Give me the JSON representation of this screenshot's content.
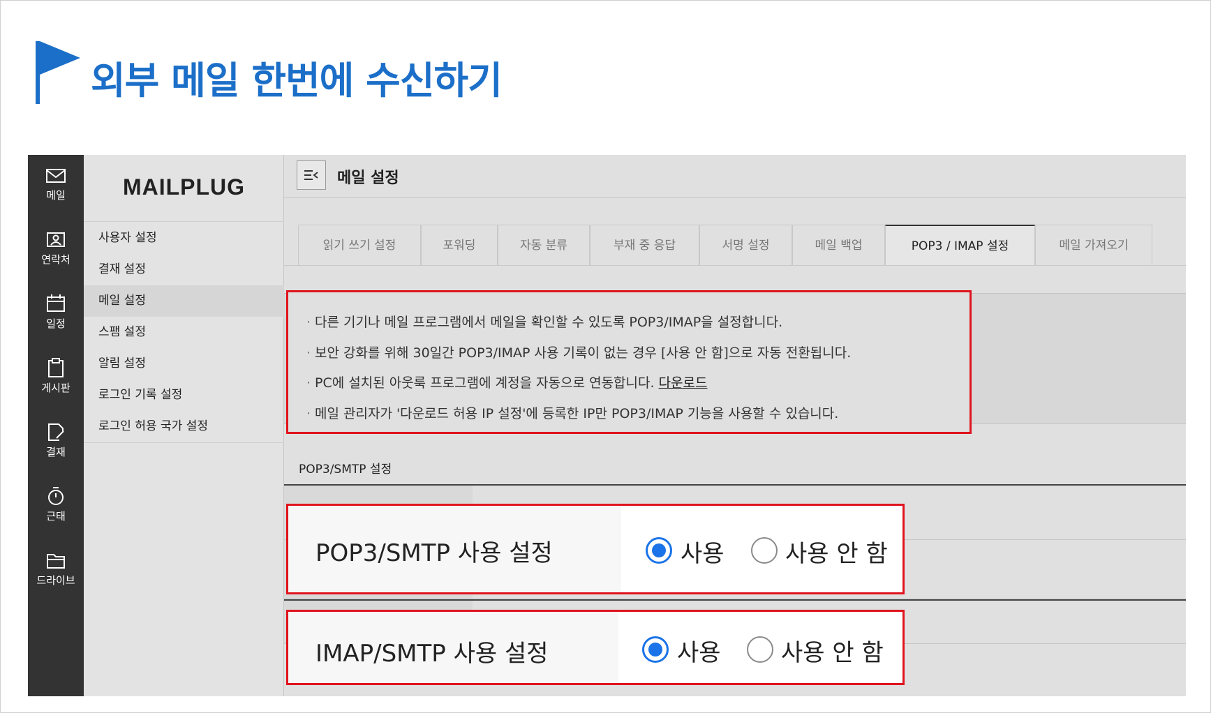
{
  "banner": {
    "title": "외부 메일 한번에 수신하기",
    "accent": "#1c6fc8"
  },
  "rail": [
    {
      "icon": "mail-icon",
      "label": "메일"
    },
    {
      "icon": "contact-card-icon",
      "label": "연락처"
    },
    {
      "icon": "calendar-icon",
      "label": "일정"
    },
    {
      "icon": "clipboard-icon",
      "label": "게시판"
    },
    {
      "icon": "edit-document-icon",
      "label": "결재"
    },
    {
      "icon": "stopwatch-icon",
      "label": "근태"
    },
    {
      "icon": "folder-icon",
      "label": "드라이브"
    }
  ],
  "sidebar": {
    "logo": "MAILPLUG",
    "items": [
      {
        "label": "사용자 설정",
        "active": false
      },
      {
        "label": "결재 설정",
        "active": false
      },
      {
        "label": "메일 설정",
        "active": true
      },
      {
        "label": "스팸 설정",
        "active": false
      },
      {
        "label": "알림 설정",
        "active": false
      },
      {
        "label": "로그인 기록 설정",
        "active": false
      },
      {
        "label": "로그인 허용 국가 설정",
        "active": false
      }
    ]
  },
  "main": {
    "title": "메일 설정",
    "tabs": [
      {
        "label": "읽기 쓰기 설정",
        "active": false
      },
      {
        "label": "포워딩",
        "active": false
      },
      {
        "label": "자동 분류",
        "active": false
      },
      {
        "label": "부재 중 응답",
        "active": false
      },
      {
        "label": "서명 설정",
        "active": false
      },
      {
        "label": "메일 백업",
        "active": false
      },
      {
        "label": "POP3 / IMAP 설정",
        "active": true
      },
      {
        "label": "메일 가져오기",
        "active": false
      }
    ],
    "notices": [
      "다른 기기나 메일 프로그램에서 메일을 확인할 수 있도록 POP3/IMAP을 설정합니다.",
      "보안 강화를 위해 30일간 POP3/IMAP 사용 기록이 없는 경우 [사용 안 함]으로 자동 전환됩니다.",
      "PC에 설치된 아웃룩 프로그램에 계정을 자동으로 연동합니다.",
      "메일 관리자가 '다운로드 허용 IP 설정'에 등록한 IP만 POP3/IMAP 기능을 사용할 수 있습니다."
    ],
    "notice_link": "다운로드",
    "section_title": "POP3/SMTP 설정",
    "settings": [
      {
        "label": "POP3/SMTP 사용 설정",
        "on_label": "사용",
        "off_label": "사용 안 함",
        "selected": "on"
      },
      {
        "label": "IMAP/SMTP 사용 설정",
        "on_label": "사용",
        "off_label": "사용 안 함",
        "selected": "on"
      }
    ]
  },
  "colors": {
    "highlight": "#e0141e",
    "radio": "#1a73e8",
    "rail": "#333333"
  }
}
